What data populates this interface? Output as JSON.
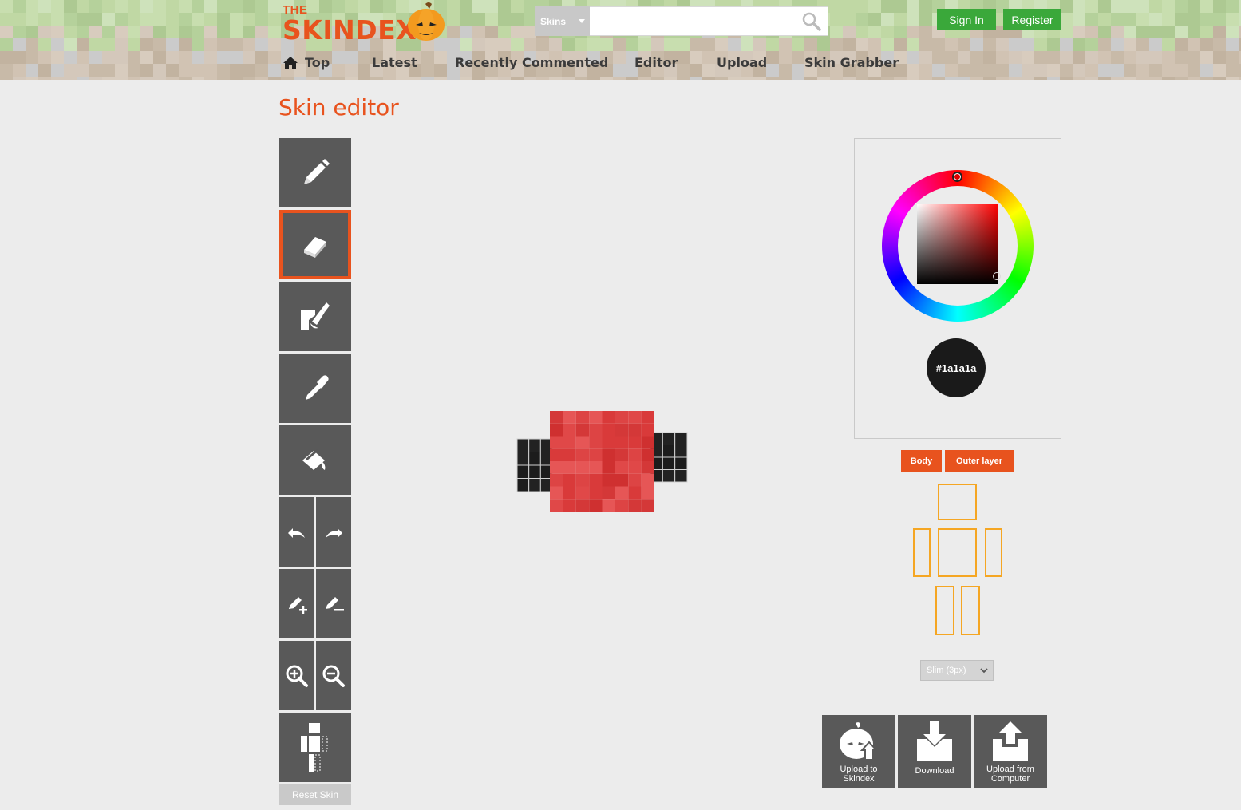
{
  "header": {
    "logo_small": "THE",
    "logo_main": "SKINDEX",
    "search": {
      "category": "Skins",
      "value": "",
      "placeholder": ""
    },
    "auth": {
      "sign_in": "Sign In",
      "register": "Register"
    },
    "nav": [
      {
        "label": "Top",
        "icon": "home-icon",
        "active": false
      },
      {
        "label": "Latest",
        "active": false
      },
      {
        "label": "Recently Commented",
        "active": false
      },
      {
        "label": "Editor",
        "active": true
      },
      {
        "label": "Upload",
        "active": false
      },
      {
        "label": "Skin Grabber",
        "active": false
      }
    ]
  },
  "page": {
    "title": "Skin editor"
  },
  "toolbar": {
    "tools": [
      {
        "name": "pencil",
        "icon": "pencil-icon",
        "selected": false
      },
      {
        "name": "eraser",
        "icon": "eraser-icon",
        "selected": true
      },
      {
        "name": "brush",
        "icon": "brush-icon",
        "selected": false
      },
      {
        "name": "eyedropper",
        "icon": "eyedropper-icon",
        "selected": false
      },
      {
        "name": "bucket",
        "icon": "paint-bucket-icon",
        "selected": false
      }
    ],
    "undo": "undo-icon",
    "redo": "redo-icon",
    "lighten": "lighten-icon",
    "darken": "darken-icon",
    "zoom_in": "zoom-in-icon",
    "zoom_out": "zoom-out-icon",
    "body_toggle": "body-parts-icon",
    "reset_label": "Reset Skin"
  },
  "color_picker": {
    "current_color": "#1a1a1a",
    "current_label": "#1a1a1a",
    "hue_color": "#ff0000"
  },
  "layers": {
    "body": "Body",
    "outer": "Outer layer"
  },
  "body_parts": [
    "head",
    "left-arm",
    "torso",
    "right-arm",
    "left-leg",
    "right-leg"
  ],
  "model": {
    "selected": "Slim (3px)"
  },
  "actions": [
    {
      "label_line1": "Upload to",
      "label_line2": "Skindex",
      "icon": "upload-skindex-icon"
    },
    {
      "label_line1": "Download",
      "label_line2": "",
      "icon": "download-icon"
    },
    {
      "label_line1": "Upload from",
      "label_line2": "Computer",
      "icon": "upload-computer-icon"
    }
  ],
  "colors": {
    "brand": "#e8531e",
    "button_green": "#3aa83a",
    "tool_bg": "#595959",
    "body_part_outline": "#f5a623"
  }
}
